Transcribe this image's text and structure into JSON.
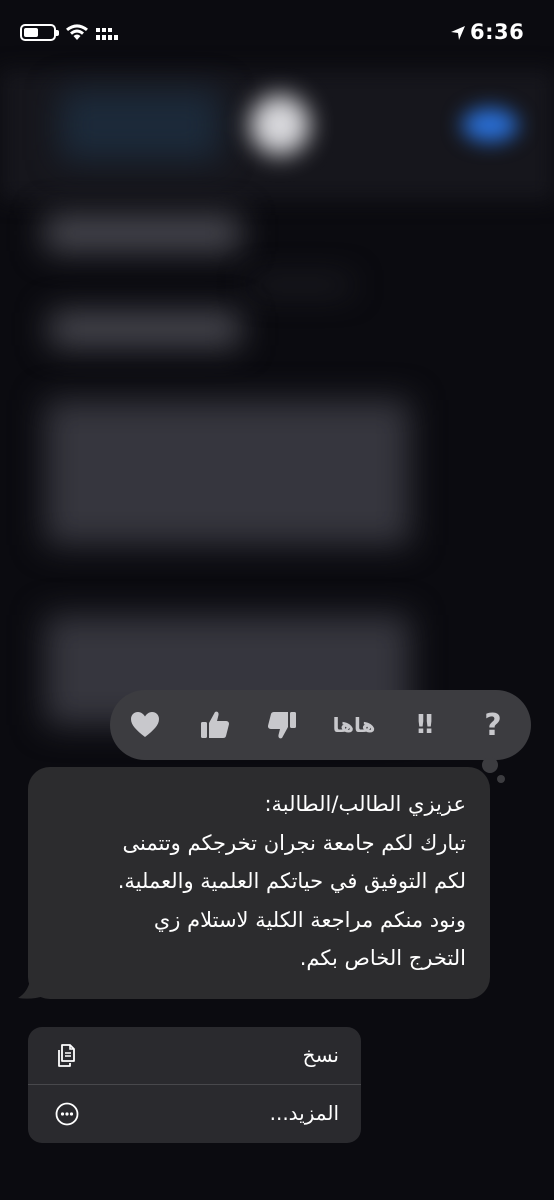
{
  "status_bar": {
    "time": "6:36",
    "icons": [
      "battery-icon",
      "wifi-icon",
      "signal-icon",
      "location-arrow-icon"
    ]
  },
  "reactions": [
    {
      "name": "heart-icon"
    },
    {
      "name": "thumbs-up-icon"
    },
    {
      "name": "thumbs-down-icon"
    },
    {
      "name": "haha",
      "label": "هاها"
    },
    {
      "name": "exclamation",
      "label": "‼"
    },
    {
      "name": "question",
      "label": "?"
    }
  ],
  "message": {
    "lines": [
      "عزيزي الطالب/الطالبة:",
      "تبارك لكم جامعة نجران تخرجكم وتتمنى",
      "لكم التوفيق في حياتكم العلمية والعملية.",
      "ونود منكم مراجعة الكلية لاستلام زي",
      "التخرج الخاص بكم."
    ]
  },
  "menu": {
    "copy": {
      "label": "نسخ",
      "icon": "copy-icon"
    },
    "more": {
      "label": "المزيد...",
      "icon": "ellipsis-circle-icon"
    }
  },
  "colors": {
    "background": "#0b0b10",
    "bubble": "#2c2c2e",
    "reaction_bar": "#3c3c40",
    "menu": "#2a2a2e",
    "reaction_icon": "#c8c8cc"
  }
}
